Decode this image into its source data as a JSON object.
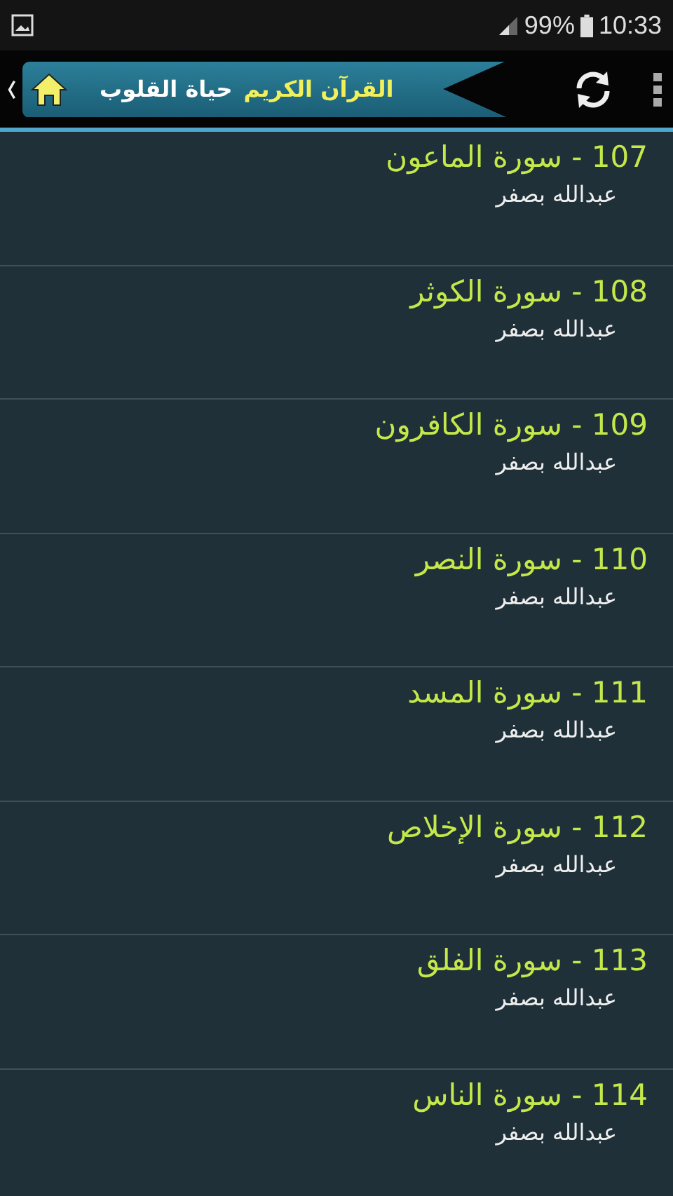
{
  "status_bar": {
    "battery": "99%",
    "time": "10:33"
  },
  "header": {
    "title": "القرآن الكريم",
    "subtitle": "حياة القلوب"
  },
  "surahs": [
    {
      "title": "107 - سورة الماعون",
      "reciter": "عبدالله بصفر"
    },
    {
      "title": "108 - سورة الكوثر",
      "reciter": "عبدالله بصفر"
    },
    {
      "title": "109 - سورة الكافرون",
      "reciter": "عبدالله بصفر"
    },
    {
      "title": "110 - سورة النصر",
      "reciter": "عبدالله بصفر"
    },
    {
      "title": "111 - سورة المسد",
      "reciter": "عبدالله بصفر"
    },
    {
      "title": "112 - سورة الإخلاص",
      "reciter": "عبدالله بصفر"
    },
    {
      "title": "113 - سورة الفلق",
      "reciter": "عبدالله بصفر"
    },
    {
      "title": "114 - سورة الناس",
      "reciter": "عبدالله بصفر"
    }
  ]
}
